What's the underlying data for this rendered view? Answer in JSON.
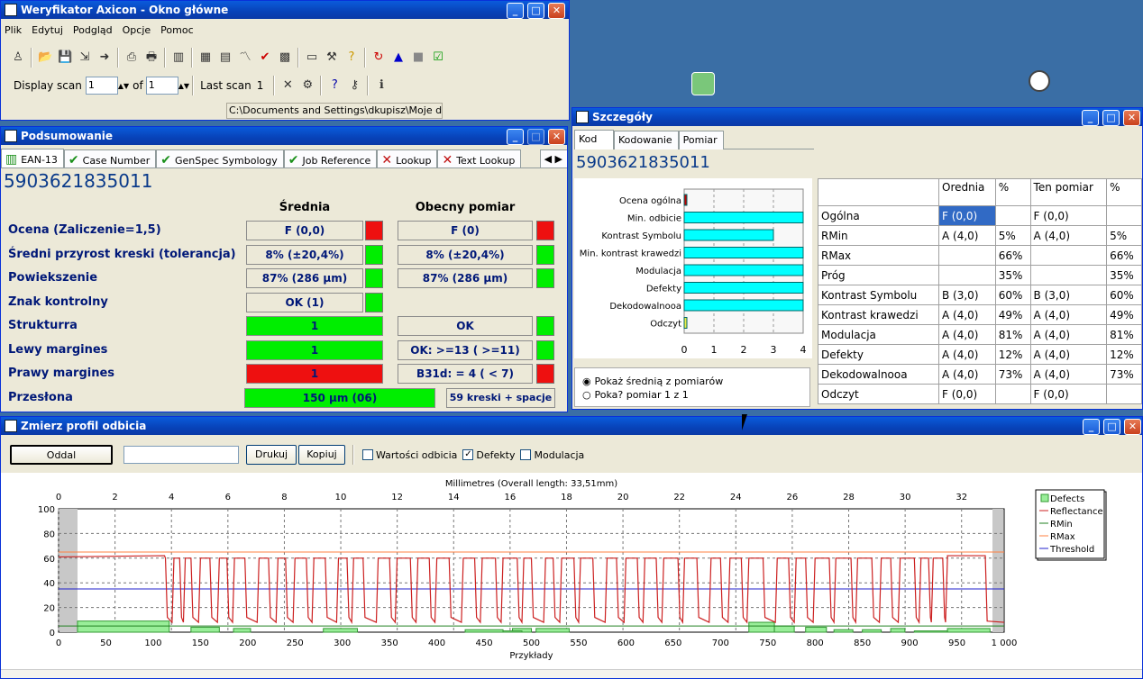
{
  "main_window": {
    "title": "Weryfikator Axicon - Okno główne",
    "menu": [
      "Plik",
      "Edytuj",
      "Podgląd",
      "Opcje",
      "Pomoc"
    ],
    "display_scan_label": "Display scan",
    "display_scan_value": "1",
    "of_label": "of",
    "of_value": "1",
    "last_scan_label": "Last scan",
    "last_scan_value": "1",
    "path": "C:\\Documents and Settings\\dkupisz\\Moje dokum"
  },
  "summary": {
    "title": "Podsumowanie",
    "tabs": [
      {
        "label": "EAN-13",
        "status": "barcode"
      },
      {
        "label": "Case Number",
        "status": "pass"
      },
      {
        "label": "GenSpec Symbology",
        "status": "pass"
      },
      {
        "label": "Job Reference",
        "status": "pass"
      },
      {
        "label": "Lookup",
        "status": "fail"
      },
      {
        "label": "Text Lookup",
        "status": "fail"
      }
    ],
    "code": "5903621835011",
    "col_avg": "Średnia",
    "col_cur": "Obecny pomiar",
    "rows": [
      {
        "label": "Ocena (Zaliczenie=1,5)",
        "avg": "F (0,0)",
        "avg_status": "fail",
        "cur": "F (0)",
        "cur_status": "fail"
      },
      {
        "label": "Średni przyrost kreski (tolerancja)",
        "avg": "8% (±20,4%)",
        "avg_status": "pass",
        "cur": "8% (±20,4%)",
        "cur_status": "pass"
      },
      {
        "label": "Powiekszenie",
        "avg": "87% (286 µm)",
        "avg_status": "pass",
        "cur": "87% (286 µm)",
        "cur_status": "pass"
      },
      {
        "label": "Znak kontrolny",
        "avg": "OK (1)",
        "avg_status": "pass",
        "cur": "",
        "cur_status": ""
      },
      {
        "label": "Strukturra",
        "avg": "1",
        "avg_status": "fill-pass",
        "cur": "OK",
        "cur_status": "pass"
      },
      {
        "label": "Lewy margines",
        "avg": "1",
        "avg_status": "fill-pass",
        "cur": "OK:   >=13 ( >=11)",
        "cur_status": "pass"
      },
      {
        "label": "Prawy margines",
        "avg": "1",
        "avg_status": "fill-fail",
        "cur": "B31d: = 4 ( <  7)",
        "cur_status": "fail"
      }
    ],
    "aperture_label": "Przesłona",
    "aperture_value": "150 µm (06)",
    "aperture_extra": "59 kreski + spacje"
  },
  "details": {
    "title": "Szczegóły",
    "tabs": [
      "Kod",
      "Kodowanie",
      "Pomiar"
    ],
    "code": "5903621835011",
    "bar_labels": [
      "Ocena ogólna",
      "Min. odbicie",
      "Kontrast Symbolu",
      "Min. kontrast krawedzi",
      "Modulacja",
      "Defekty",
      "Dekodowalnooa",
      "Odczyt"
    ],
    "bar_values": [
      0,
      4,
      3,
      4,
      4,
      4,
      4,
      0
    ],
    "bar_axis": [
      "0",
      "1",
      "2",
      "3",
      "4"
    ],
    "radio1": "Pokaż średnią z pomiarów",
    "radio2": "Poka? pomiar 1 z 1",
    "table_headers": [
      "",
      "Orednia",
      "%",
      "Ten pomiar",
      "%"
    ],
    "table_rows": [
      [
        "Ogólna",
        "F (0,0)",
        "",
        "F (0,0)",
        ""
      ],
      [
        "RMin",
        "A (4,0)",
        "5%",
        "A (4,0)",
        "5%"
      ],
      [
        "RMax",
        "",
        "66%",
        "",
        "66%"
      ],
      [
        "Próg",
        "",
        "35%",
        "",
        "35%"
      ],
      [
        "Kontrast Symbolu",
        "B (3,0)",
        "60%",
        "B (3,0)",
        "60%"
      ],
      [
        "Kontrast krawedzi",
        "A (4,0)",
        "49%",
        "A (4,0)",
        "49%"
      ],
      [
        "Modulacja",
        "A (4,0)",
        "81%",
        "A (4,0)",
        "81%"
      ],
      [
        "Defekty",
        "A (4,0)",
        "12%",
        "A (4,0)",
        "12%"
      ],
      [
        "Dekodowalnooa",
        "A (4,0)",
        "73%",
        "A (4,0)",
        "73%"
      ],
      [
        "Odczyt",
        "F (0,0)",
        "",
        "F (0,0)",
        ""
      ]
    ]
  },
  "profile": {
    "title": "Zmierz profil odbicia",
    "btn_zoom": "Oddal",
    "btn_print": "Drukuj",
    "btn_copy": "Kopiuj",
    "cb_reflect": "Wartości odbicia",
    "cb_defects": "Defekty",
    "cb_mod": "Modulacja",
    "chart_data": {
      "type": "line",
      "title": "Millimetres (Overall length: 33,51mm)",
      "xlabel": "Przykłady",
      "x_top_ticks": [
        "0",
        "2",
        "4",
        "6",
        "8",
        "10",
        "12",
        "14",
        "16",
        "18",
        "20",
        "22",
        "24",
        "26",
        "28",
        "30",
        "32"
      ],
      "x_bottom_ticks": [
        "0",
        "50",
        "100",
        "150",
        "200",
        "250",
        "300",
        "350",
        "400",
        "450",
        "500",
        "550",
        "600",
        "650",
        "700",
        "750",
        "800",
        "850",
        "900",
        "950",
        "1 000"
      ],
      "y_ticks": [
        "0",
        "20",
        "40",
        "60",
        "80",
        "100"
      ],
      "ylim": [
        0,
        100
      ],
      "xlim": [
        0,
        1000
      ],
      "rmin": 5,
      "rmax": 65,
      "threshold": 35,
      "legend": [
        "Defects",
        "Reflectance",
        "RMin",
        "RMax",
        "Threshold"
      ],
      "colors": {
        "defects": "#99ee99",
        "reflectance": "#cc2020",
        "rmin": "#208020",
        "rmax": "#ff8040",
        "threshold": "#2020cc"
      }
    }
  }
}
